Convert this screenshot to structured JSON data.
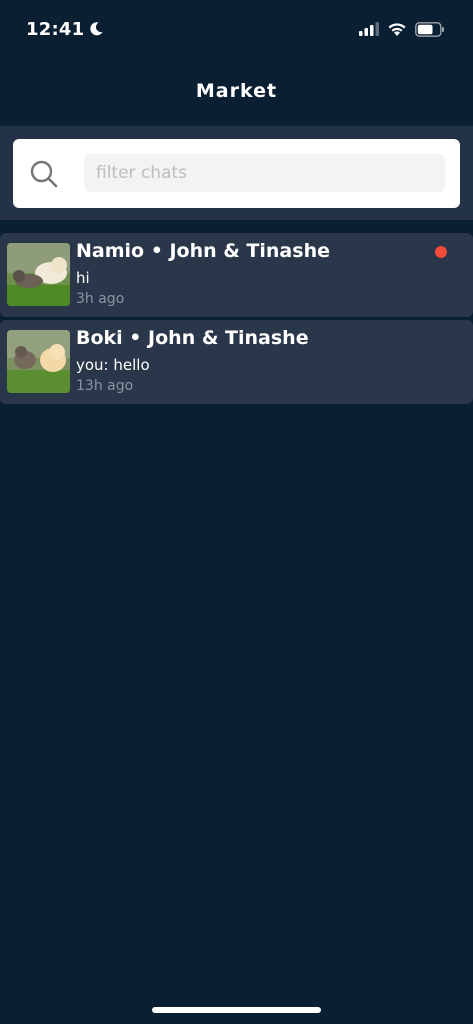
{
  "status": {
    "time": "12:41",
    "battery_level": 0.7
  },
  "header": {
    "title": "Market"
  },
  "search": {
    "placeholder": "filter chats"
  },
  "chats": [
    {
      "title": "Namio • John & Tinashe",
      "preview": "hi",
      "time": "3h ago",
      "unread": true
    },
    {
      "title": "Boki • John & Tinashe",
      "preview": "you: hello",
      "time": "13h ago",
      "unread": false
    }
  ],
  "colors": {
    "background": "#0b1f33",
    "row": "#2a3649",
    "unread": "#f44a3a"
  }
}
